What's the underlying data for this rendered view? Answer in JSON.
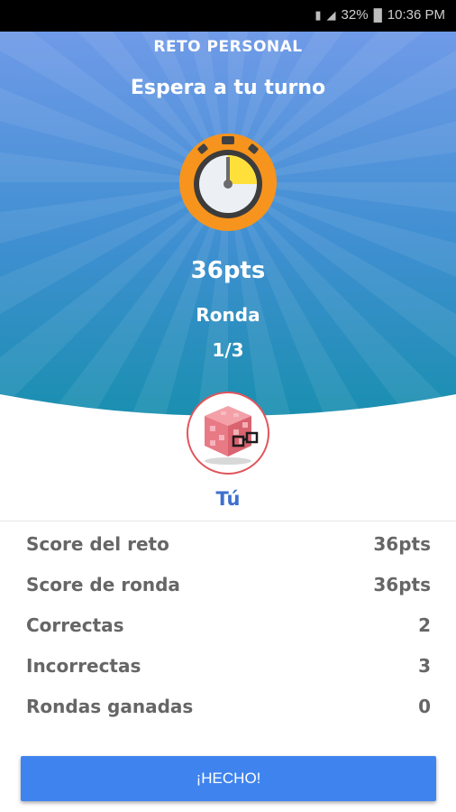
{
  "status_bar": {
    "battery": "32%",
    "time": "10:36 PM",
    "icons": [
      "vibrate-icon",
      "signal-icon",
      "battery-icon"
    ]
  },
  "hero": {
    "title": "RETO PERSONAL",
    "subtitle": "Espera a tu turno",
    "points": "36pts",
    "round_label": "Ronda",
    "round_value": "1/3",
    "timer_icon": "stopwatch-icon",
    "colors": {
      "top": "#6f9ae8",
      "bottom": "#1a8fb0",
      "timer_ring": "#f7941d",
      "timer_fill": "#ffe03a"
    }
  },
  "player": {
    "name": "Tú",
    "avatar_icon": "pixel-cube-with-glasses-icon"
  },
  "stats": [
    {
      "label": "Score del reto",
      "value": "36pts"
    },
    {
      "label": "Score de ronda",
      "value": "36pts"
    },
    {
      "label": "Correctas",
      "value": "2"
    },
    {
      "label": "Incorrectas",
      "value": "3"
    },
    {
      "label": "Rondas ganadas",
      "value": "0"
    }
  ],
  "done_button": {
    "label": "¡HECHO!"
  }
}
